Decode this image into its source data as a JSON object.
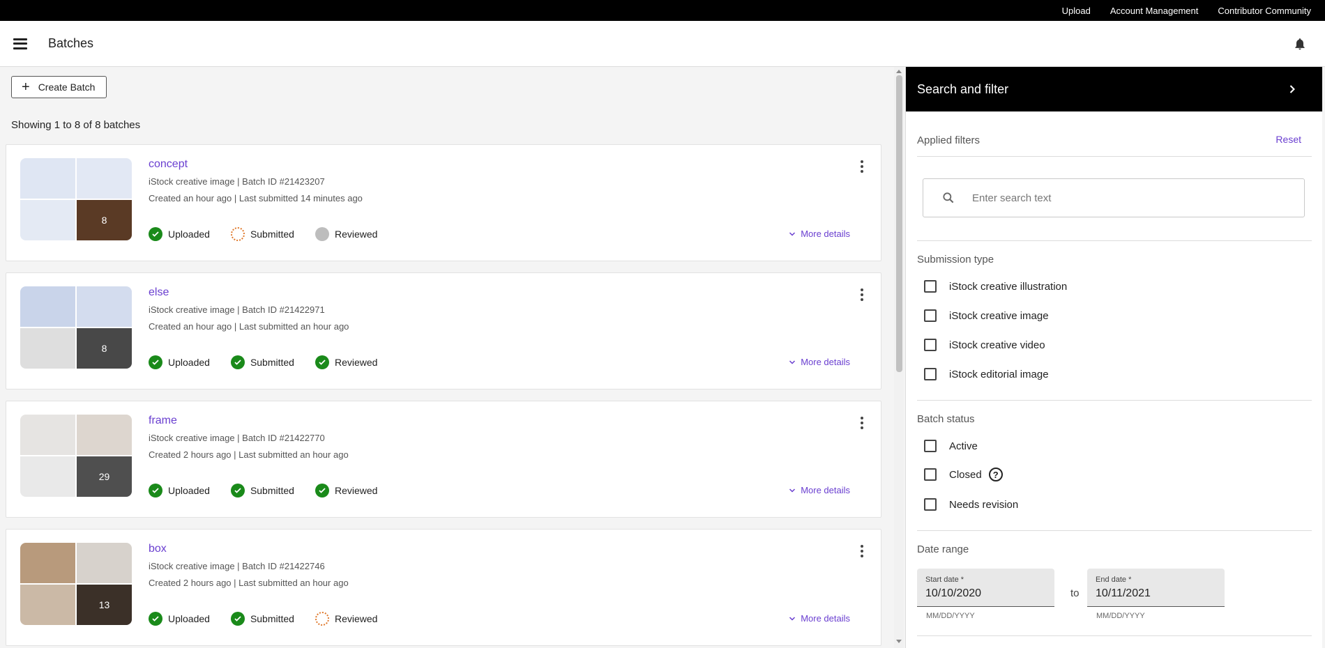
{
  "topnav": {
    "upload": "Upload",
    "account": "Account Management",
    "community": "Contributor Community"
  },
  "header": {
    "title": "Batches"
  },
  "toolbar": {
    "create_label": "Create Batch"
  },
  "summary": "Showing 1 to 8 of 8 batches",
  "statuses": {
    "uploaded": "Uploaded",
    "submitted": "Submitted",
    "reviewed": "Reviewed"
  },
  "more_details": "More details",
  "batches": [
    {
      "title": "concept",
      "info": "iStock creative image | Batch ID #21423207",
      "dates": "Created an hour ago | Last submitted 14 minutes ago",
      "count": "8",
      "uploaded_state": "done",
      "submitted_state": "progress",
      "reviewed_state": "pending",
      "thumb_colors": [
        "#dfe6f3",
        "#e2e8f4",
        "#e4eaf4",
        "#8a5a3a"
      ]
    },
    {
      "title": "else",
      "info": "iStock creative image | Batch ID #21422971",
      "dates": "Created an hour ago | Last submitted an hour ago",
      "count": "8",
      "uploaded_state": "done",
      "submitted_state": "done",
      "reviewed_state": "done",
      "thumb_colors": [
        "#c9d4ea",
        "#d3dcee",
        "#dedede",
        "#6f6f6f"
      ]
    },
    {
      "title": "frame",
      "info": "iStock creative image | Batch ID #21422770",
      "dates": "Created 2 hours ago | Last submitted an hour ago",
      "count": "29",
      "uploaded_state": "done",
      "submitted_state": "done",
      "reviewed_state": "done",
      "thumb_colors": [
        "#e6e4e2",
        "#ddd6cf",
        "#e9e9e9",
        "#7a7a7a"
      ]
    },
    {
      "title": "box",
      "info": "iStock creative image | Batch ID #21422746",
      "dates": "Created 2 hours ago | Last submitted an hour ago",
      "count": "13",
      "uploaded_state": "done",
      "submitted_state": "done",
      "reviewed_state": "progress",
      "thumb_colors": [
        "#b89a7c",
        "#d7d2cc",
        "#cbb9a6",
        "#5b4a3e"
      ]
    }
  ],
  "panel": {
    "title": "Search and filter",
    "applied_filters": "Applied filters",
    "reset": "Reset",
    "search_placeholder": "Enter search text",
    "submission_type": {
      "label": "Submission type",
      "options": [
        "iStock creative illustration",
        "iStock creative image",
        "iStock creative video",
        "iStock editorial image"
      ]
    },
    "batch_status": {
      "label": "Batch status",
      "options": [
        "Active",
        "Closed",
        "Needs revision"
      ]
    },
    "date_range": {
      "label": "Date range",
      "start_label": "Start date *",
      "start_value": "10/10/2020",
      "end_label": "End date *",
      "end_value": "10/11/2021",
      "hint": "MM/DD/YYYY",
      "to": "to"
    }
  },
  "colors": {
    "accent": "#6a3fd0",
    "success": "#1a8a1a",
    "warning": "#e07a2e"
  }
}
